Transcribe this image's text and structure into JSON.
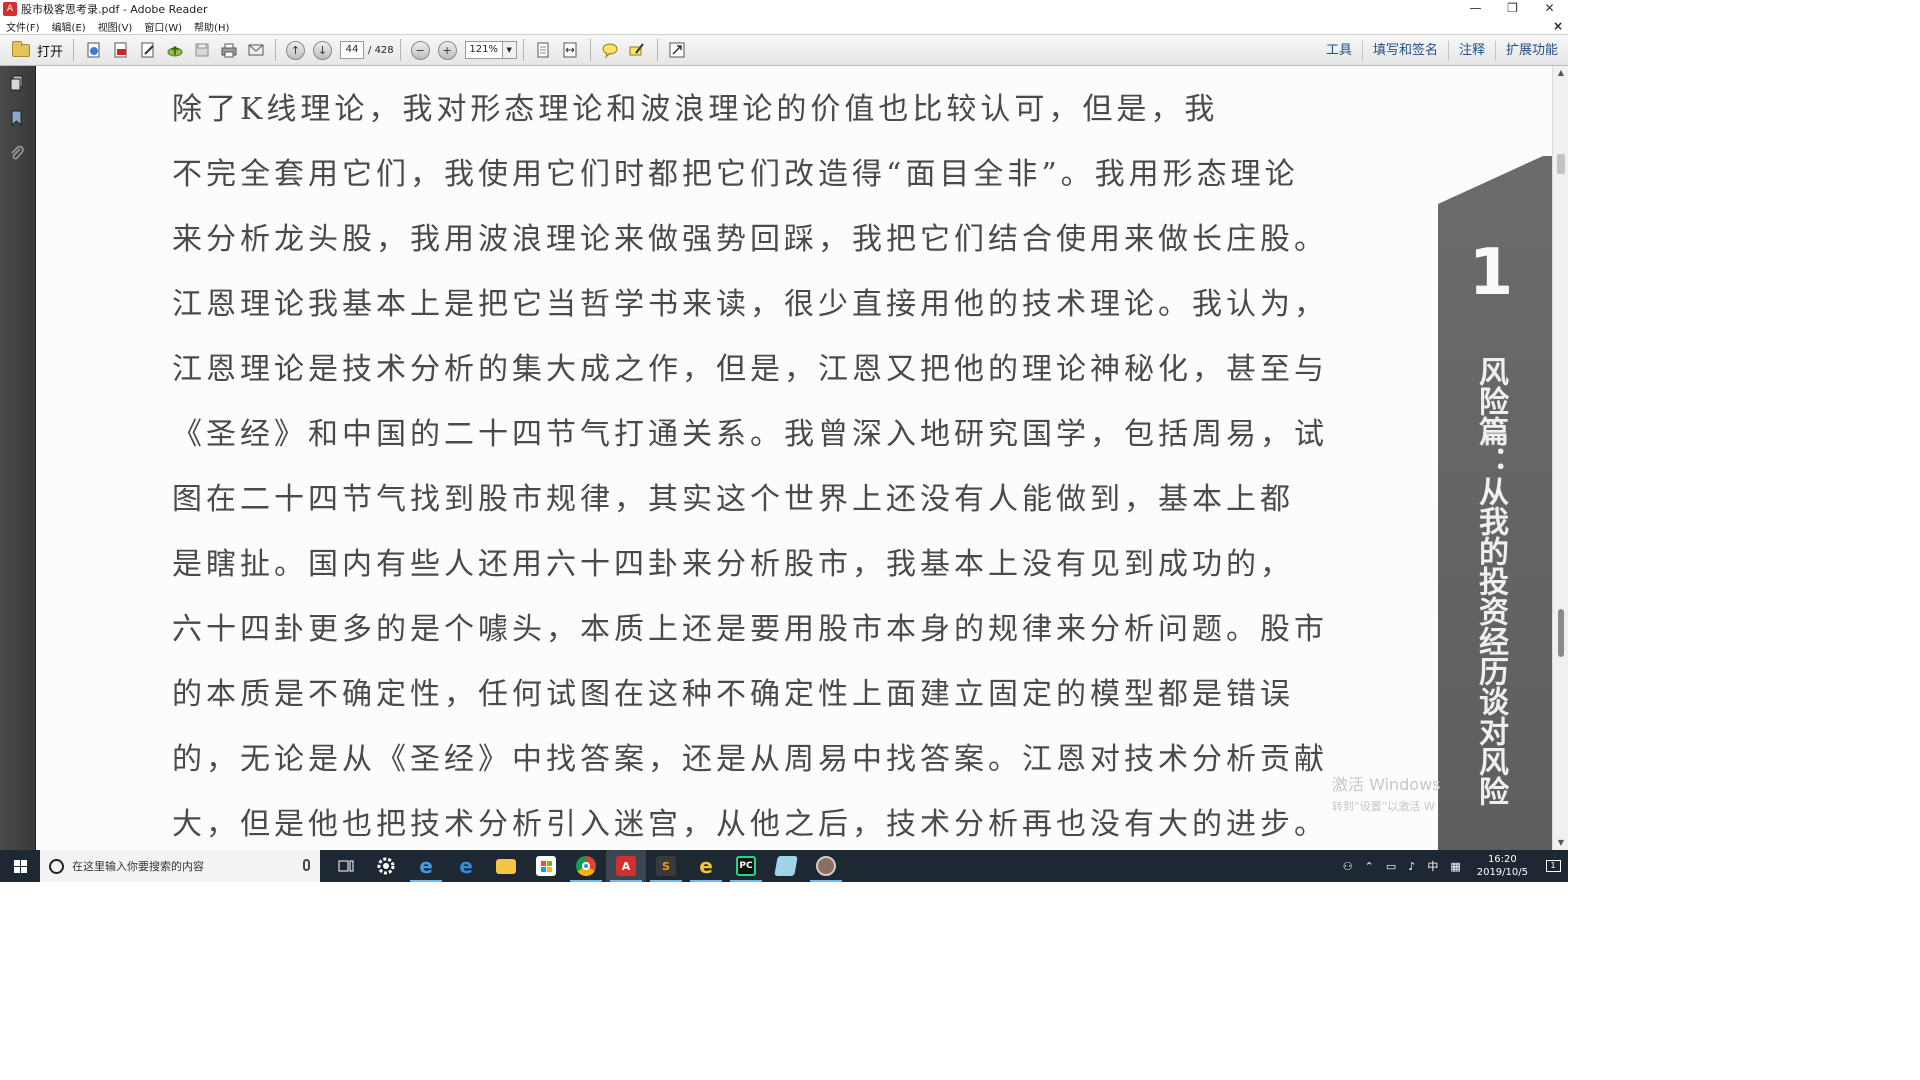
{
  "window": {
    "title": "股市极客思考录.pdf - Adobe Reader",
    "app_icon_glyph": "A",
    "minimize": "—",
    "maximize": "❐",
    "close": "✕",
    "doc_close": "×"
  },
  "menu": {
    "items": [
      "文件(F)",
      "编辑(E)",
      "视图(V)",
      "窗口(W)",
      "帮助(H)"
    ]
  },
  "toolbar": {
    "open_label": "打开",
    "page_current": "44",
    "page_total": "/ 428",
    "zoom": "121%",
    "prev_page_glyph": "↑",
    "next_page_glyph": "↓",
    "zoom_out_glyph": "−",
    "zoom_in_glyph": "+",
    "dropdown_glyph": "▼",
    "right_tabs": [
      "工具",
      "填写和签名",
      "注释",
      "扩展功能"
    ]
  },
  "document": {
    "lines": [
      "  除了K线理论，我对形态理论和波浪理论的价值也比较认可，但是，我",
      "不完全套用它们，我使用它们时都把它们改造得“面目全非”。我用形态理论",
      "来分析龙头股，我用波浪理论来做强势回踩，我把它们结合使用来做长庄股。",
      "江恩理论我基本上是把它当哲学书来读，很少直接用他的技术理论。我认为，",
      "江恩理论是技术分析的集大成之作，但是，江恩又把他的理论神秘化，甚至与",
      "《圣经》和中国的二十四节气打通关系。我曾深入地研究国学，包括周易，试",
      "图在二十四节气找到股市规律，其实这个世界上还没有人能做到，基本上都",
      "是瞎扯。国内有些人还用六十四卦来分析股市，我基本上没有见到成功的，",
      "六十四卦更多的是个噱头，本质上还是要用股市本身的规律来分析问题。股市",
      "的本质是不确定性，任何试图在这种不确定性上面建立固定的模型都是错误",
      "的，无论是从《圣经》中找答案，还是从周易中找答案。江恩对技术分析贡献",
      "大，但是他也把技术分析引入迷宫，从他之后，技术分析再也没有大的进步。"
    ],
    "banner_number": "1",
    "banner_text": "风险篇：从我的投资经历谈对风险"
  },
  "watermark": {
    "line1": "激活 Windows",
    "line2": "转到“设置”以激活 W"
  },
  "taskbar": {
    "search_placeholder": "在这里输入你要搜索的内容",
    "ime": "中",
    "time": "16:20",
    "date": "2019/10/5",
    "notification_count": "1"
  },
  "colors": {
    "toolbar_link": "#1f4f8a",
    "taskbar_bg": "#1e2833",
    "left_panel": "#3f3f3f",
    "banner": "#636363"
  }
}
